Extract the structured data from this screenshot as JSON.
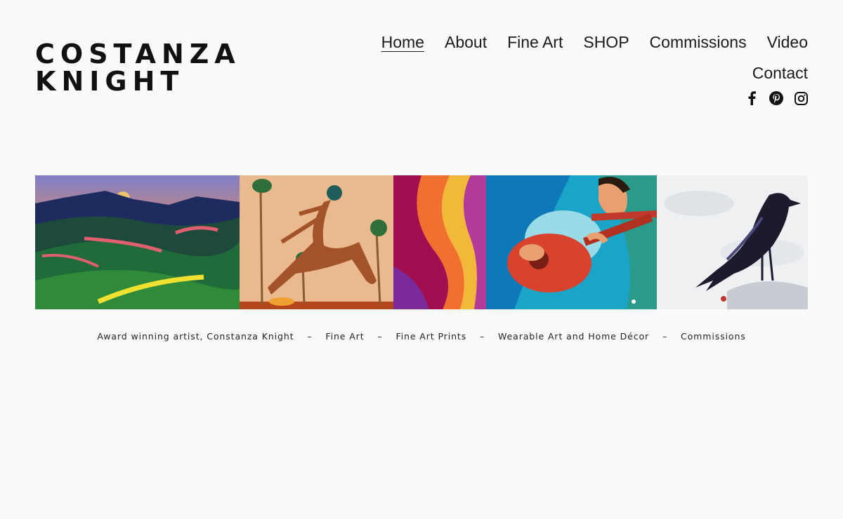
{
  "logo": {
    "line1": "COSTANZA",
    "line2": "KNIGHT"
  },
  "nav": {
    "row1": [
      {
        "label": "Home",
        "active": true
      },
      {
        "label": "About"
      },
      {
        "label": "Fine Art"
      },
      {
        "label": "SHOP"
      },
      {
        "label": "Commissions"
      },
      {
        "label": "Video"
      }
    ],
    "row2": [
      {
        "label": "Contact"
      }
    ]
  },
  "social": [
    "facebook-icon",
    "pinterest-icon",
    "instagram-icon"
  ],
  "tagline": {
    "part1": "Award winning artist, Constanza Knight",
    "part2": "Fine Art",
    "part3": "Fine Art Prints",
    "part4": "Wearable Art and Home Décor",
    "part5": "Commissions",
    "separator": "–"
  },
  "colors": {
    "background": "#fafafa",
    "text": "#1a1a1a"
  }
}
